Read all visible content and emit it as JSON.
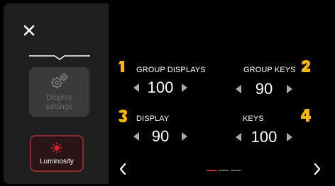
{
  "sidebar": {
    "close_icon": "close-icon",
    "display_settings": {
      "label": "Display settings",
      "icon": "gears-icon"
    },
    "luminosity": {
      "label": "Luminosity",
      "icon": "sun-icon"
    }
  },
  "groups": [
    {
      "badge": "1",
      "label": "GROUP DISPLAYS",
      "value": "100"
    },
    {
      "badge": "2",
      "label": "GROUP KEYS",
      "value": "90"
    },
    {
      "badge": "3",
      "label": "DISPLAY",
      "value": "90"
    },
    {
      "badge": "4",
      "label": "KEYS",
      "value": "100"
    }
  ],
  "pagination": {
    "current": 1,
    "total": 3
  },
  "colors": {
    "badge": "#f6b40f",
    "accent": "#d8242d"
  }
}
